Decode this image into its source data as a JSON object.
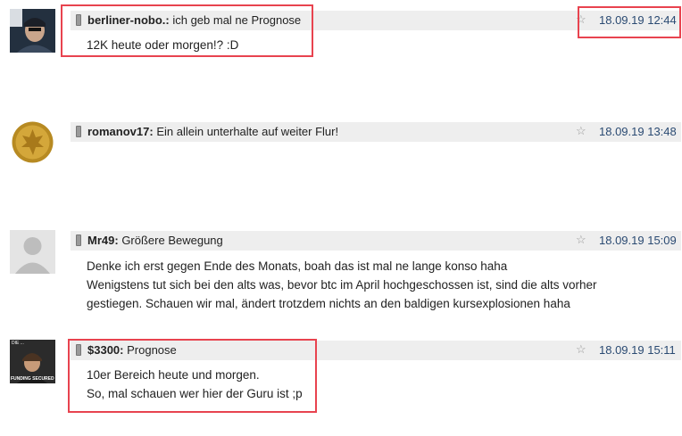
{
  "posts": [
    {
      "author": "berliner-nobo.:",
      "subject": "ich geb mal ne Prognose",
      "date": "18.09.19 12:44",
      "lines": [
        "12K heute oder morgen!? :D"
      ]
    },
    {
      "author": "romanov17:",
      "subject": "Ein allein unterhalte auf weiter Flur!",
      "date": "18.09.19 13:48",
      "lines": []
    },
    {
      "author": "Mr49:",
      "subject": "Größere Bewegung",
      "date": "18.09.19 15:09",
      "lines": [
        "Denke ich erst gegen Ende des Monats, boah das ist mal ne lange konso haha",
        "Wenigstens tut sich bei den alts was, bevor btc im April hochgeschossen ist, sind die alts vorher",
        "gestiegen. Schauen wir mal, ändert trotzdem nichts an den baldigen kursexplosionen haha"
      ]
    },
    {
      "author": "$3300:",
      "subject": "Prognose",
      "date": "18.09.19 15:11",
      "lines": [
        "10er Bereich heute und morgen.",
        "So, mal schauen wer hier der Guru ist ;p"
      ],
      "avatar_text": "DIE ...",
      "avatar_caption": "FUNDING SECURED"
    }
  ],
  "icons": {
    "mobile": "mobile-phone-icon",
    "star": "star-icon"
  },
  "colors": {
    "highlight": "#e8434f",
    "date": "#2a4a72",
    "header_bg": "#eeeeee"
  }
}
